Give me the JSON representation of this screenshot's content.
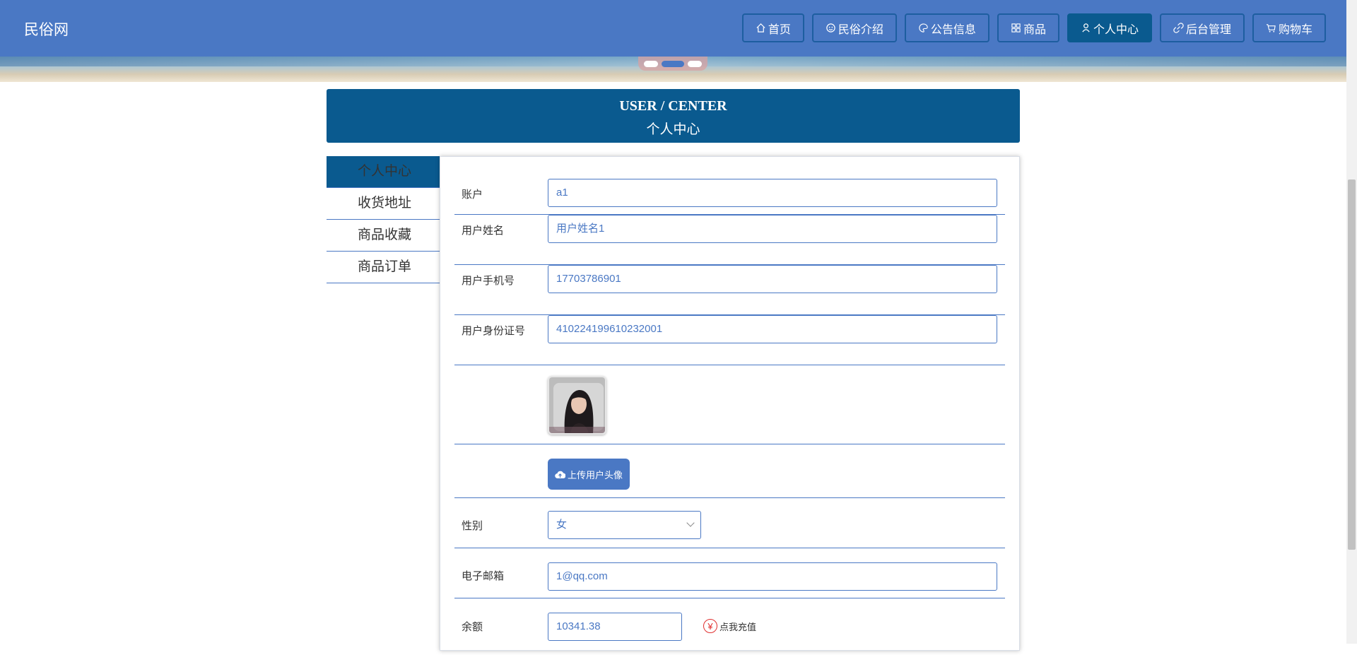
{
  "brand": "民俗网",
  "nav": [
    {
      "label": "首页",
      "icon": "home-icon",
      "active": false
    },
    {
      "label": "民俗介绍",
      "icon": "smile-icon",
      "active": false
    },
    {
      "label": "公告信息",
      "icon": "palette-icon",
      "active": false
    },
    {
      "label": "商品",
      "icon": "grid-icon",
      "active": false
    },
    {
      "label": "个人中心",
      "icon": "user-icon",
      "active": true
    },
    {
      "label": "后台管理",
      "icon": "link-icon",
      "active": false
    },
    {
      "label": "购物车",
      "icon": "cart-icon",
      "active": false
    }
  ],
  "carousel": {
    "count": 3,
    "active_index": 1
  },
  "header": {
    "en": "USER / CENTER",
    "zh": "个人中心"
  },
  "side_menu": [
    {
      "label": "个人中心",
      "active": true
    },
    {
      "label": "收货地址",
      "active": false
    },
    {
      "label": "商品收藏",
      "active": false
    },
    {
      "label": "商品订单",
      "active": false
    }
  ],
  "form": {
    "account_label": "账户",
    "account_value": "a1",
    "name_label": "用户姓名",
    "name_value": "用户姓名1",
    "phone_label": "用户手机号",
    "phone_value": "17703786901",
    "idcard_label": "用户身份证号",
    "idcard_value": "410224199610232001",
    "upload_label": "上传用户头像",
    "gender_label": "性别",
    "gender_value": "女",
    "email_label": "电子邮箱",
    "email_value": "1@qq.com",
    "balance_label": "余额",
    "balance_value": "10341.38",
    "recharge_label": "点我充值",
    "yen_symbol": "¥"
  },
  "colors": {
    "primary": "#4a78c4",
    "dark": "#0a5a8f",
    "danger": "#e03030"
  }
}
